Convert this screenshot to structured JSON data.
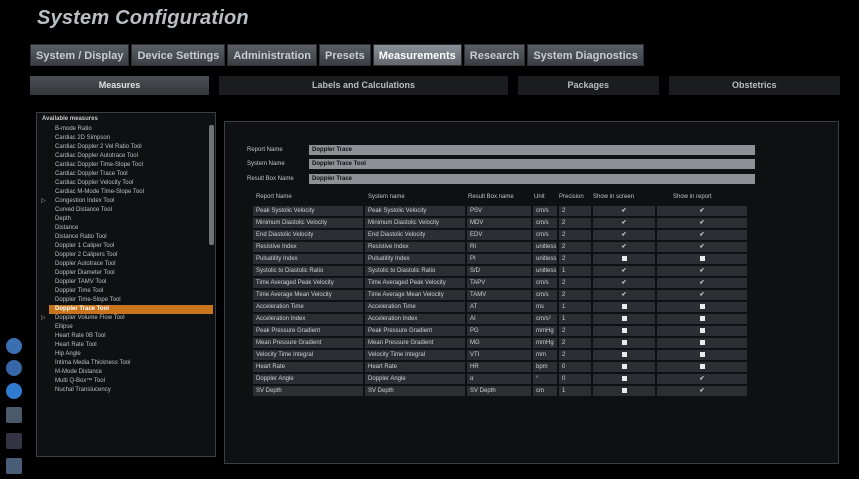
{
  "title": "System Configuration",
  "main_tabs": [
    "System / Display",
    "Device Settings",
    "Administration",
    "Presets",
    "Measurements",
    "Research",
    "System Diagnostics"
  ],
  "active_main_tab": "Measurements",
  "sub_tabs": [
    "Measures",
    "Labels and Calculations",
    "Packages",
    "Obstetrics"
  ],
  "active_sub_tab": "Measures",
  "left": {
    "header": "Available measures",
    "items": [
      {
        "label": "B-mode Ratio"
      },
      {
        "label": "Cardiac 2D Simpson"
      },
      {
        "label": "Cardiac Doppler 2 Vel Ratio Tool"
      },
      {
        "label": "Cardiac Doppler Autotrace Tool"
      },
      {
        "label": "Cardiac Doppler Time-Slope Tool"
      },
      {
        "label": "Cardiac Doppler Trace Tool"
      },
      {
        "label": "Cardiac Doppler Velocity Tool"
      },
      {
        "label": "Cardiac M-Mode Time-Slope Tool"
      },
      {
        "label": "Congestion Index Tool",
        "expandable": true
      },
      {
        "label": "Curved Distance Tool"
      },
      {
        "label": "Depth"
      },
      {
        "label": "Distance"
      },
      {
        "label": "Distance Ratio Tool"
      },
      {
        "label": "Doppler 1 Caliper Tool"
      },
      {
        "label": "Doppler 2 Calipers Tool"
      },
      {
        "label": "Doppler Autotrace Tool"
      },
      {
        "label": "Doppler Diameter Tool"
      },
      {
        "label": "Doppler TAMV Tool"
      },
      {
        "label": "Doppler Time Tool"
      },
      {
        "label": "Doppler Time-Slope Tool"
      },
      {
        "label": "Doppler Trace Tool",
        "selected": true
      },
      {
        "label": "Doppler Volume Flow Tool",
        "expandable": true
      },
      {
        "label": "Ellipse"
      },
      {
        "label": "Heart Rate 0B Tool"
      },
      {
        "label": "Heart Rate Tool"
      },
      {
        "label": "Hip Angle"
      },
      {
        "label": "Intima Media Thickness Tool"
      },
      {
        "label": "M-Mode Distance"
      },
      {
        "label": "Multi Q-Box™ Tool"
      },
      {
        "label": "Nuchal Translucency"
      }
    ]
  },
  "fields": {
    "report_name_label": "Report Name",
    "report_name_value": "Doppler Trace",
    "system_name_label": "System Name",
    "system_name_value": "Doppler Trace Tool",
    "result_box_label": "Result Box Name",
    "result_box_value": "Doppler Trace"
  },
  "grid": {
    "headers": [
      "Report Name",
      "System name",
      "Result Box name",
      "Unit",
      "Precision",
      "Show in screen",
      "Show in report"
    ],
    "rows": [
      {
        "report": "Peak Systolic Velocity",
        "system": "Peak Systolic Velocity",
        "box": "PSV",
        "unit": "cm/s",
        "precision": "2",
        "screen": "check",
        "report_show": "check"
      },
      {
        "report": "Minimum Diastolic Velocity",
        "system": "Minimum Diastolic Velocity",
        "box": "MDV",
        "unit": "cm/s",
        "precision": "2",
        "screen": "check",
        "report_show": "check"
      },
      {
        "report": "End Diastolic Velocity",
        "system": "End Diastolic Velocity",
        "box": "EDV",
        "unit": "cm/s",
        "precision": "2",
        "screen": "check",
        "report_show": "check"
      },
      {
        "report": "Resistive Index",
        "system": "Resistive Index",
        "box": "RI",
        "unit": "unitless",
        "precision": "2",
        "screen": "check",
        "report_show": "check"
      },
      {
        "report": "Pulsatility Index",
        "system": "Pulsatility Index",
        "box": "PI",
        "unit": "unitless",
        "precision": "2",
        "screen": "square",
        "report_show": "square"
      },
      {
        "report": "Systolic to Diastolic Ratio",
        "system": "Systolic to Diastolic Ratio",
        "box": "S/D",
        "unit": "unitless",
        "precision": "1",
        "screen": "check",
        "report_show": "check"
      },
      {
        "report": "Time Averaged Peak Velocity",
        "system": "Time Averaged Peak Velocity",
        "box": "TAPV",
        "unit": "cm/s",
        "precision": "2",
        "screen": "check",
        "report_show": "check"
      },
      {
        "report": "Time Average Mean Velocity",
        "system": "Time Average Mean Velocity",
        "box": "TAMV",
        "unit": "cm/s",
        "precision": "2",
        "screen": "check",
        "report_show": "check"
      },
      {
        "report": "Acceleration Time",
        "system": "Acceleration Time",
        "box": "AT",
        "unit": "ms",
        "precision": "1",
        "screen": "square",
        "report_show": "square"
      },
      {
        "report": "Acceleration Index",
        "system": "Acceleration Index",
        "box": "AI",
        "unit": "cm/s²",
        "precision": "1",
        "screen": "square",
        "report_show": "square"
      },
      {
        "report": "Peak Pressure Gradient",
        "system": "Peak Pressure Gradient",
        "box": "PG",
        "unit": "mmHg",
        "precision": "2",
        "screen": "square",
        "report_show": "square"
      },
      {
        "report": "Mean Pressure Gradient",
        "system": "Mean Pressure Gradient",
        "box": "MG",
        "unit": "mmHg",
        "precision": "2",
        "screen": "square",
        "report_show": "square"
      },
      {
        "report": "Velocity Time Integral",
        "system": "Velocity Time Integral",
        "box": "VTI",
        "unit": "mm",
        "precision": "2",
        "screen": "square",
        "report_show": "square"
      },
      {
        "report": "Heart Rate",
        "system": "Heart Rate",
        "box": "HR",
        "unit": "bpm",
        "precision": "0",
        "screen": "square",
        "report_show": "square"
      },
      {
        "report": "Doppler Angle",
        "system": "Doppler Angle",
        "box": "α",
        "unit": "°",
        "precision": "0",
        "screen": "square",
        "report_show": "check"
      },
      {
        "report": "SV Depth",
        "system": "SV Depth",
        "box": "SV Depth",
        "unit": "cm",
        "precision": "1",
        "screen": "square",
        "report_show": "check"
      }
    ]
  },
  "colors": {
    "selected": "#c8741c",
    "check": "#c6ef3b",
    "field_bg": "#8d9196"
  }
}
